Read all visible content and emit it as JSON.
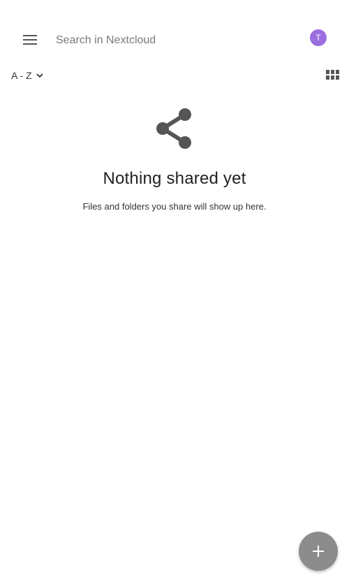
{
  "colors": {
    "icon": "#555555",
    "avatar_bg": "#9b6ee0",
    "fab_bg": "#8c8c8c",
    "fab_icon": "#ffffff"
  },
  "toolbar": {
    "menu_icon": "hamburger-menu-icon",
    "search": {
      "placeholder": "Search in Nextcloud",
      "value": ""
    },
    "avatar_initial": "T"
  },
  "sort": {
    "label": "A - Z",
    "chevron_icon": "chevron-down-icon",
    "view_icon": "grid-view-icon"
  },
  "empty_state": {
    "icon": "share-icon",
    "title": "Nothing shared yet",
    "subtitle": "Files and folders you share will show up here."
  },
  "fab": {
    "icon": "plus-icon"
  }
}
